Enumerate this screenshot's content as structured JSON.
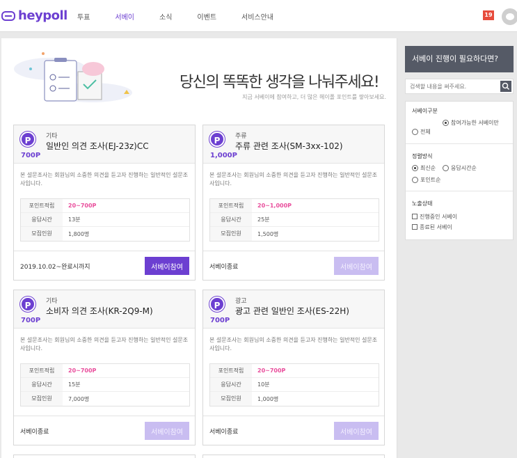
{
  "header": {
    "logo": "heypoll",
    "nav": [
      "투표",
      "서베이",
      "소식",
      "이벤트",
      "서비스안내"
    ],
    "active_nav": "서베이",
    "notification_count": "19"
  },
  "hero": {
    "title": "당신의 똑똑한 생각을 나눠주세요!",
    "subtitle": "지금 서베이에 참여하고, 더 많은 헤이폴 포인트를 쌓아보세요."
  },
  "info_labels": {
    "points": "포인트적립",
    "time": "응답시간",
    "quota": "모집인원"
  },
  "cards": [
    {
      "points": "700P",
      "category": "기타",
      "title": "일반인 의견 조사(EJ-23z)CC",
      "desc": "본 설문조사는 회원님의 소중한 의견을 듣고자 진행하는 일반적인 설문조사입니다.",
      "point_range": "20~700P",
      "time": "13분",
      "quota": "1,800명",
      "footer": "2019.10.02~완료시까지",
      "button": "서베이참여",
      "enabled": true
    },
    {
      "points": "1,000P",
      "category": "주류",
      "title": "주류 관련 조사(SM-3xx-102)",
      "desc": "본 설문조사는 회원님의 소중한 의견을 듣고자 진행하는 일반적인 설문조사입니다.",
      "point_range": "20~1,000P",
      "time": "25분",
      "quota": "1,500명",
      "footer": "서베이종료",
      "button": "서베이참여",
      "enabled": false
    },
    {
      "points": "700P",
      "category": "기타",
      "title": "소비자 의견 조사(KR-2Q9-M)",
      "desc": "본 설문조사는 회원님의 소중한 의견을 듣고자 진행하는 일반적인 설문조사입니다.",
      "point_range": "20~700P",
      "time": "15분",
      "quota": "7,000명",
      "footer": "서베이종료",
      "button": "서베이참여",
      "enabled": false
    },
    {
      "points": "700P",
      "category": "광고",
      "title": "광고 관련 일반인 조사(ES-22H)",
      "desc": "본 설문조사는 회원님의 소중한 의견을 듣고자 진행하는 일반적인 설문조사입니다.",
      "point_range": "20~700P",
      "time": "10분",
      "quota": "1,000명",
      "footer": "서베이종료",
      "button": "서베이참여",
      "enabled": false
    }
  ],
  "sidebar": {
    "heading": "서베이 진행이 필요하다면?",
    "search_placeholder": "검색할 내용을 써주세요.",
    "group1_title": "서베이구분",
    "group1_opt1": "전체",
    "group1_opt2": "참여가능한 서베이만",
    "group2_title": "정렬방식",
    "group2_opt1": "최신순",
    "group2_opt2": "응답시간순",
    "group2_opt3": "포인트순",
    "group3_title": "노출상태",
    "group3_opt1": "진행중인 서베이",
    "group3_opt2": "종료된 서베이"
  },
  "colors": {
    "brand": "#6c3fd1",
    "pink": "#e94e9c",
    "sidebar_head": "#555a66"
  }
}
